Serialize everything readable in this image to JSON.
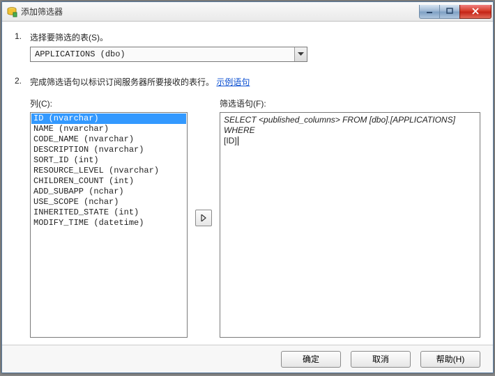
{
  "window": {
    "title": "添加筛选器"
  },
  "step1": {
    "num": "1.",
    "label": "选择要筛选的表(S)。",
    "combo_value": "APPLICATIONS (dbo)"
  },
  "step2": {
    "num": "2.",
    "label_prefix": "完成筛选语句以标识订阅服务器所要接收的表行。",
    "link": "示例语句"
  },
  "columns": {
    "label": "列(C):",
    "items": [
      "ID (nvarchar)",
      "NAME (nvarchar)",
      "CODE_NAME (nvarchar)",
      "DESCRIPTION (nvarchar)",
      "SORT_ID (int)",
      "RESOURCE_LEVEL (nvarchar)",
      "CHILDREN_COUNT (int)",
      "ADD_SUBAPP (nchar)",
      "USE_SCOPE (nchar)",
      "INHERITED_STATE (int)",
      "MODIFY_TIME (datetime)"
    ],
    "selected_index": 0
  },
  "filter": {
    "label": "筛选语句(F):",
    "text_line1": "SELECT <published_columns> FROM [dbo].[APPLICATIONS] WHERE",
    "text_line2": "[ID]"
  },
  "buttons": {
    "ok": "确定",
    "cancel": "取消",
    "help": "帮助(H)"
  }
}
